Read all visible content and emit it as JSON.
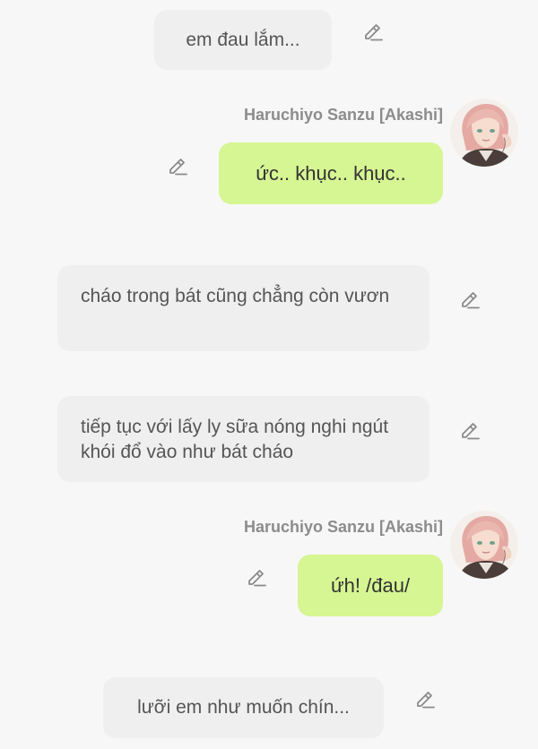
{
  "colors": {
    "background": "#f7f7f7",
    "narration_bubble": "#efefef",
    "character_bubble": "#d6f593",
    "name_text": "#8c8c8c",
    "edit_icon": "#8a8a8a"
  },
  "messages": [
    {
      "type": "narration",
      "text": "em đau lắm..."
    },
    {
      "type": "character",
      "name": "Haruchiyo Sanzu [Akashi]",
      "text": "ức.. khục.. khục..",
      "avatar": "avatar-image"
    },
    {
      "type": "narration",
      "text": "cháo trong bát cũng chẳng còn vươn"
    },
    {
      "type": "narration",
      "text": "tiếp tục với lấy ly sữa nóng nghi ngút khói đổ vào như bát cháo"
    },
    {
      "type": "character",
      "name": "Haruchiyo Sanzu [Akashi]",
      "text": "ứh! /đau/",
      "avatar": "avatar-image"
    },
    {
      "type": "narration",
      "text": "lưỡi em như muốn chín..."
    }
  ],
  "icons": {
    "edit": "pencil-edit-icon"
  }
}
